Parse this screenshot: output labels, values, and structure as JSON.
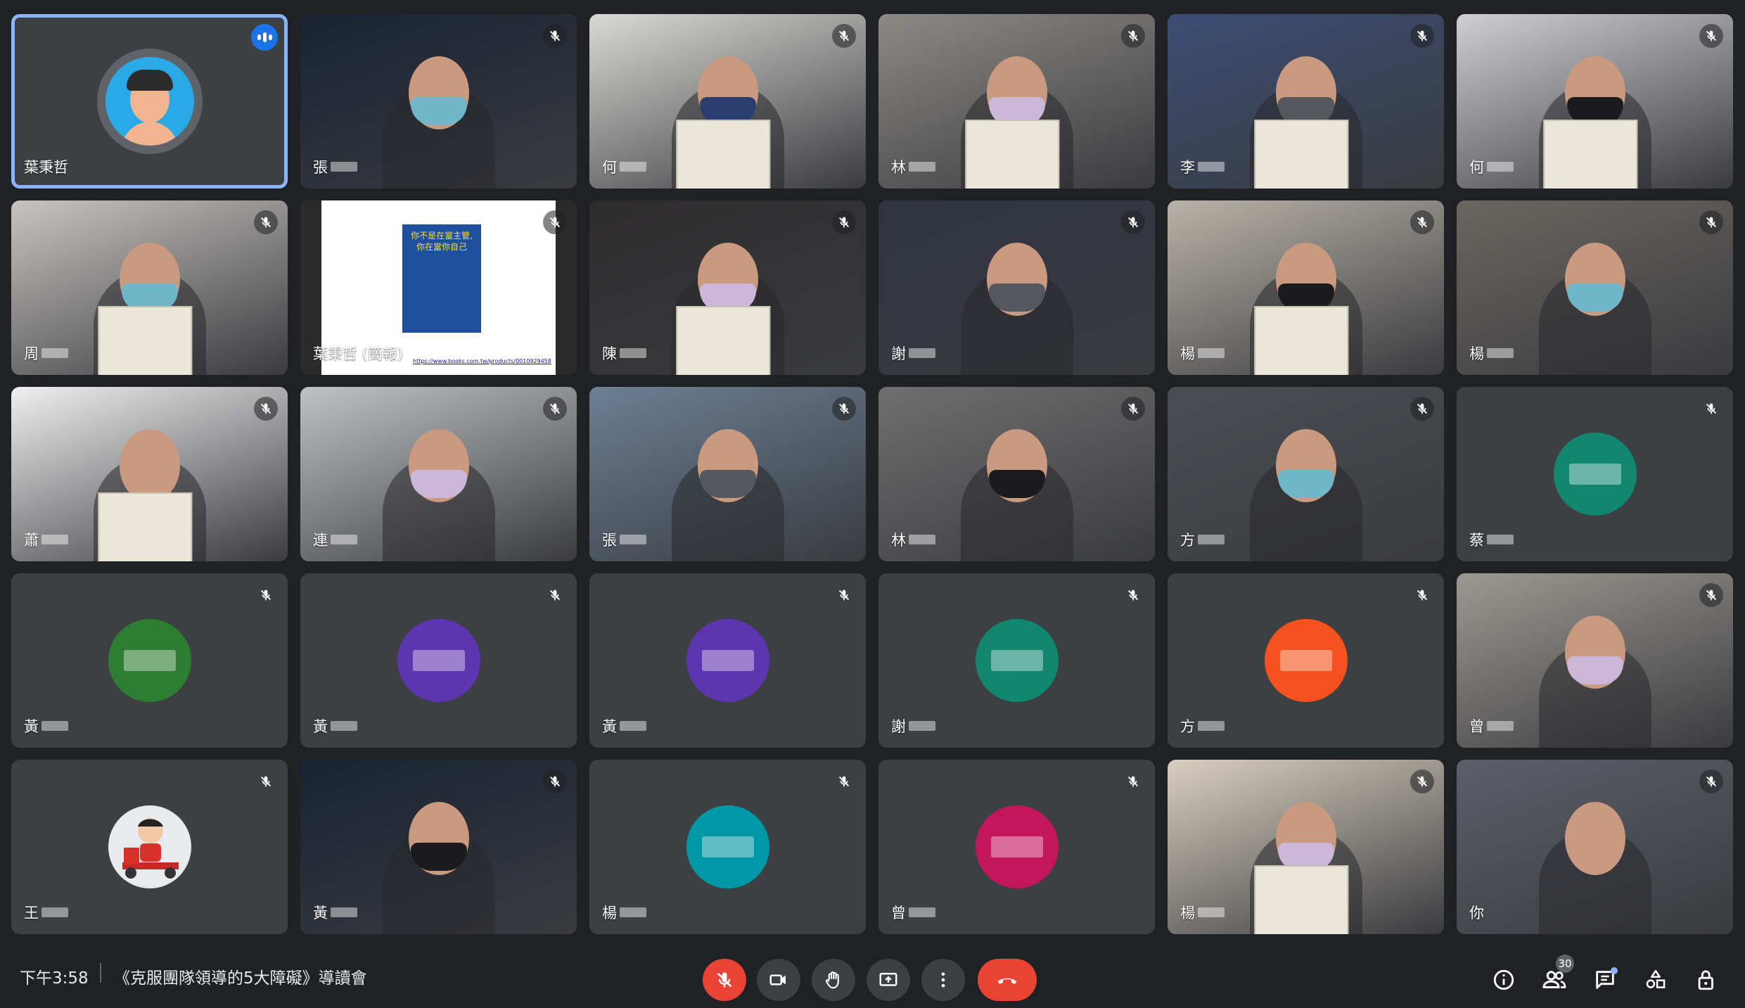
{
  "meeting": {
    "time": "下午3:58",
    "title": "《克服團隊領導的5大障礙》導讀會",
    "participant_count": "30"
  },
  "tiles": [
    {
      "name": "葉秉哲",
      "kind": "avatar",
      "color": "#3c4043",
      "speaking": true
    },
    {
      "name": "張",
      "kind": "video",
      "bg": "#1a2333"
    },
    {
      "name": "何",
      "kind": "video",
      "bg": "#d9d9d4"
    },
    {
      "name": "林",
      "kind": "video",
      "bg": "#8d8a85"
    },
    {
      "name": "李",
      "kind": "video",
      "bg": "#3b4d73"
    },
    {
      "name": "何",
      "kind": "video",
      "bg": "#cfcfd1"
    },
    {
      "name": "周",
      "kind": "video",
      "bg": "#c8c4c0"
    },
    {
      "name": "葉秉哲 (簡報)",
      "kind": "screen",
      "bg": "#ffffff",
      "book_title": "你不是在當主管, 你在當你自己",
      "url": "https://www.books.com.tw/products/0010929458"
    },
    {
      "name": "陳",
      "kind": "video",
      "bg": "#2e2c2d"
    },
    {
      "name": "謝",
      "kind": "video",
      "bg": "#2f3440"
    },
    {
      "name": "楊",
      "kind": "video",
      "bg": "#b9b2a8"
    },
    {
      "name": "楊",
      "kind": "video",
      "bg": "#6b6660"
    },
    {
      "name": "蕭",
      "kind": "video",
      "bg": "#efefef"
    },
    {
      "name": "連",
      "kind": "video",
      "bg": "#bfc2c3"
    },
    {
      "name": "張",
      "kind": "video",
      "bg": "#6c7f94"
    },
    {
      "name": "林",
      "kind": "video",
      "bg": "#6f6f6f"
    },
    {
      "name": "方",
      "kind": "video",
      "bg": "#4a4d52"
    },
    {
      "name": "蔡",
      "kind": "avatar",
      "color": "#12876f"
    },
    {
      "name": "黃",
      "kind": "avatar",
      "color": "#2d7d32"
    },
    {
      "name": "黃",
      "kind": "avatar",
      "color": "#5e35b1"
    },
    {
      "name": "黃",
      "kind": "avatar",
      "color": "#5e35b1"
    },
    {
      "name": "謝",
      "kind": "avatar",
      "color": "#12876f"
    },
    {
      "name": "方",
      "kind": "avatar",
      "color": "#f4511e"
    },
    {
      "name": "曾",
      "kind": "video",
      "bg": "#9d9992"
    },
    {
      "name": "王",
      "kind": "avatar-img",
      "color": "#e8eaed"
    },
    {
      "name": "黃",
      "kind": "video",
      "bg": "#1a2333"
    },
    {
      "name": "楊",
      "kind": "avatar",
      "color": "#0097a7"
    },
    {
      "name": "曾",
      "kind": "avatar",
      "color": "#c2185b"
    },
    {
      "name": "楊",
      "kind": "video",
      "bg": "#d8cfc0"
    },
    {
      "name": "你",
      "kind": "video",
      "bg": "#5b5f68"
    }
  ],
  "controls": {
    "mic": "mic-off",
    "camera": "camera",
    "raise_hand": "hand",
    "present": "present",
    "more": "more",
    "end": "end-call"
  },
  "colors": {
    "speaking": "#1a73e8",
    "active_border": "#8ab4f8",
    "danger": "#ea4335"
  }
}
